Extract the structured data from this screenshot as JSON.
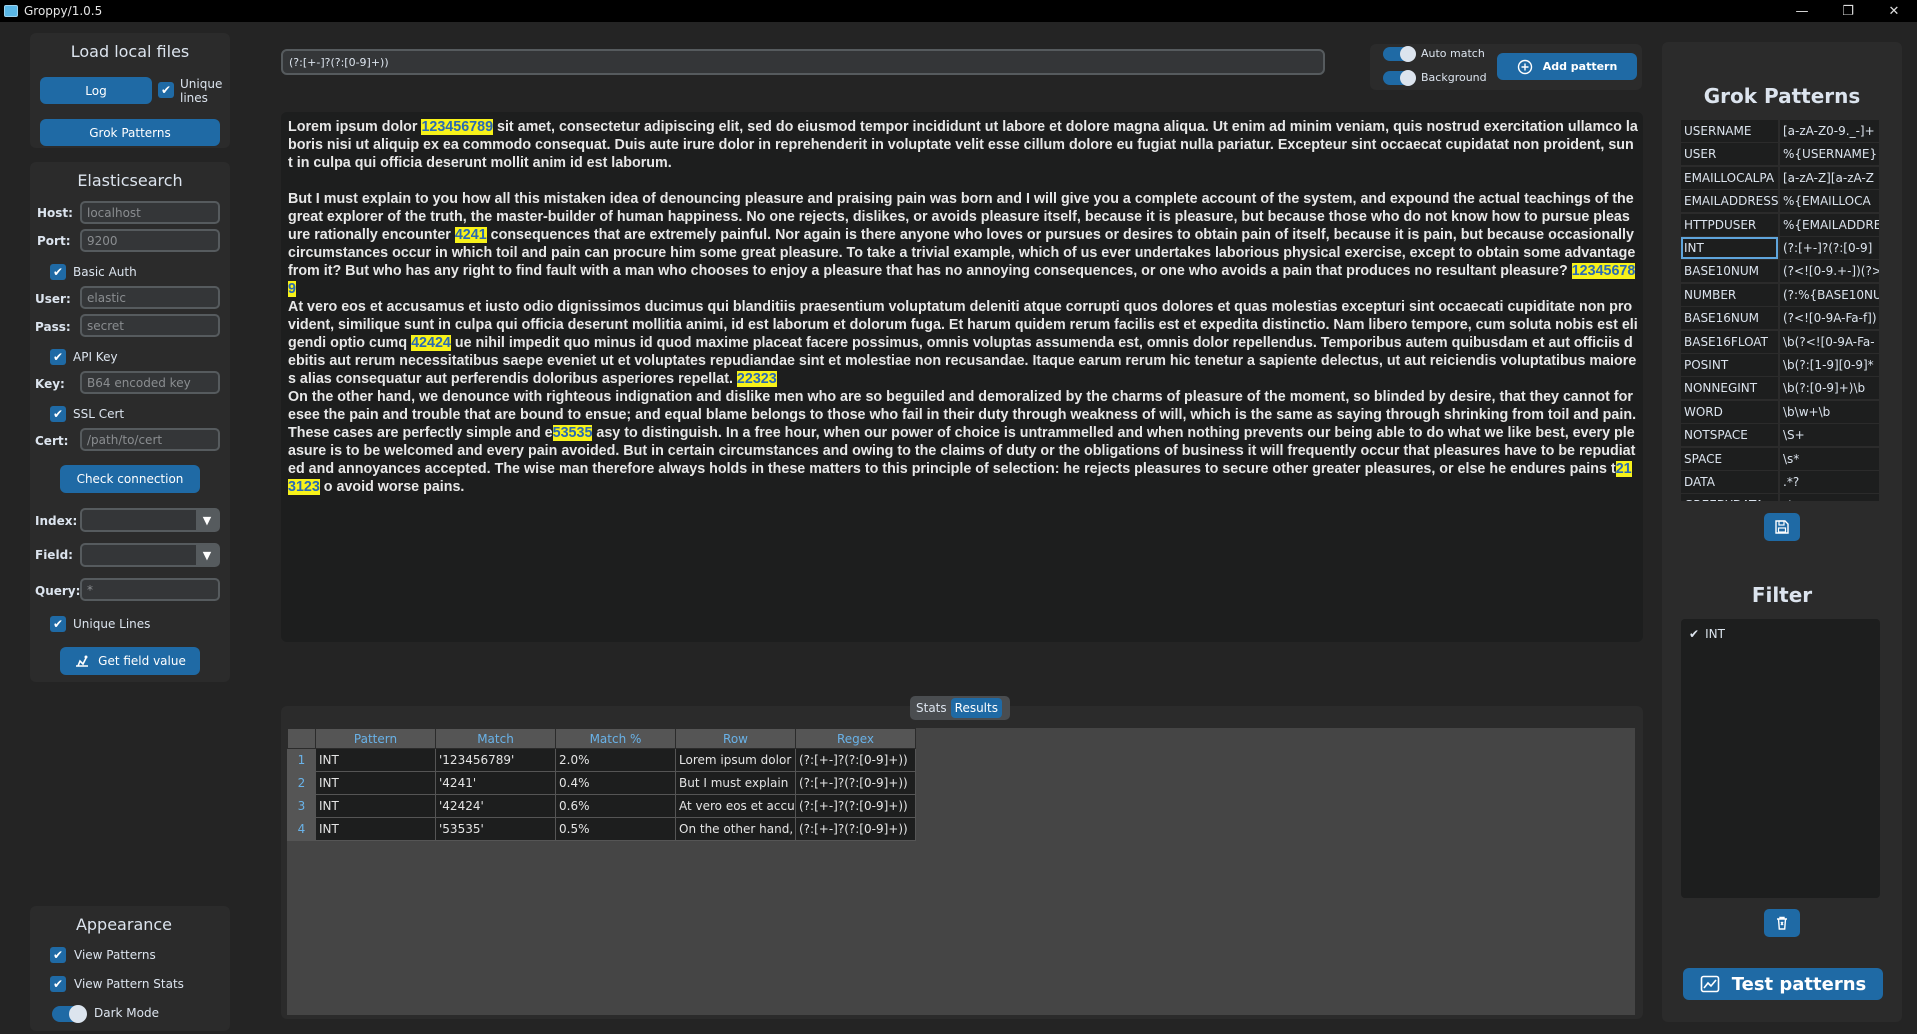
{
  "window": {
    "title": "Groppy/1.0.5"
  },
  "sidebar": {
    "load_title": "Load local files",
    "log_button": "Log",
    "unique_lines_label_1": "Unique",
    "unique_lines_label_2": "lines",
    "grok_button": "Grok Patterns",
    "es_title": "Elasticsearch",
    "host_label": "Host:",
    "host_placeholder": "localhost",
    "port_label": "Port:",
    "port_placeholder": "9200",
    "basic_auth_label": "Basic Auth",
    "user_label": "User:",
    "user_placeholder": "elastic",
    "pass_label": "Pass:",
    "pass_placeholder": "secret",
    "api_key_label": "API Key",
    "key_label": "Key:",
    "key_placeholder": "B64 encoded key",
    "ssl_label": "SSL Cert",
    "cert_label": "Cert:",
    "cert_placeholder": "/path/to/cert",
    "check_button": "Check connection",
    "index_label": "Index:",
    "field_label": "Field:",
    "query_label": "Query:",
    "query_placeholder": "*",
    "unique_lines": "Unique Lines",
    "get_field_button": "Get field value",
    "appearance_title": "Appearance",
    "view_patterns": "View Patterns",
    "view_pattern_stats": "View Pattern Stats",
    "dark_mode": "Dark Mode"
  },
  "toolbar": {
    "regex_value": "(?:[+-]?(?:[0-9]+))",
    "auto_match": "Auto match",
    "background": "Background",
    "add_pattern": "Add pattern"
  },
  "text": {
    "segments": [
      {
        "t": "Lorem ipsum dolor "
      },
      {
        "t": "123456789",
        "h": true
      },
      {
        "t": " sit amet, consectetur adipiscing elit, sed do eiusmod tempor incididunt ut labore et dolore magna aliqua. Ut enim ad minim veniam, quis nostrud exercitation ullamco laboris nisi ut aliquip ex ea commodo consequat. Duis aute irure dolor in reprehenderit in voluptate velit esse cillum dolore eu fugiat nulla pariatur. Excepteur sint occaecat cupidatat non proident, sunt in culpa qui officia deserunt mollit anim id est laborum.\n\nBut I must explain to you how all this mistaken idea of denouncing pleasure and praising pain was born and I will give you a complete account of the system, and expound the actual teachings of the great explorer of the truth, the master-builder of human happiness. No one rejects, dislikes, or avoids pleasure itself, because it is pleasure, but because those who do not know how to pursue pleasure rationally encounter "
      },
      {
        "t": "4241",
        "h": true
      },
      {
        "t": " consequences that are extremely painful. Nor again is there anyone who loves or pursues or desires to obtain pain of itself, because it is pain, but because occasionally circumstances occur in which toil and pain can procure him some great pleasure. To take a trivial example, which of us ever undertakes laborious physical exercise, except to obtain some advantage from it? But who has any right to find fault with a man who chooses to enjoy a pleasure that has no annoying consequences, or one who avoids a pain that produces no resultant pleasure? "
      },
      {
        "t": "123456789",
        "h": true
      },
      {
        "t": "\nAt vero eos et accusamus et iusto odio dignissimos ducimus qui blanditiis praesentium voluptatum deleniti atque corrupti quos dolores et quas molestias excepturi sint occaecati cupiditate non provident, similique sunt in culpa qui officia deserunt mollitia animi, id est laborum et dolorum fuga. Et harum quidem rerum facilis est et expedita distinctio. Nam libero tempore, cum soluta nobis est eligendi optio cumq "
      },
      {
        "t": "42424",
        "h": true
      },
      {
        "t": " ue nihil impedit quo minus id quod maxime placeat facere possimus, omnis voluptas assumenda est, omnis dolor repellendus. Temporibus autem quibusdam et aut officiis debitis aut rerum necessitatibus saepe eveniet ut et voluptates repudiandae sint et molestiae non recusandae. Itaque earum rerum hic tenetur a sapiente delectus, ut aut reiciendis voluptatibus maiores alias consequatur aut perferendis doloribus asperiores repellat. "
      },
      {
        "t": "22323",
        "h": true
      },
      {
        "t": "\nOn the other hand, we denounce with righteous indignation and dislike men who are so beguiled and demoralized by the charms of pleasure of the moment, so blinded by desire, that they cannot foresee the pain and trouble that are bound to ensue; and equal blame belongs to those who fail in their duty through weakness of will, which is the same as saying through shrinking from toil and pain. These cases are perfectly simple and e"
      },
      {
        "t": "53535",
        "h": true
      },
      {
        "t": " asy to distinguish. In a free hour, when our power of choice is untrammelled and when nothing prevents our being able to do what we like best, every pleasure is to be welcomed and every pain avoided. But in certain circumstances and owing to the claims of duty or the obligations of business it will frequently occur that pleasures have to be repudiated and annoyances accepted. The wise man therefore always holds in these matters to this principle of selection: he rejects pleasures to secure other greater pleasures, or else he endures pains t"
      },
      {
        "t": "213123",
        "h": true
      },
      {
        "t": " o avoid worse pains."
      }
    ]
  },
  "tabs": {
    "stats": "Stats",
    "results": "Results"
  },
  "results": {
    "columns": [
      "Pattern",
      "Match",
      "Match %",
      "Row",
      "Regex"
    ],
    "rows": [
      {
        "n": "1",
        "pattern": "INT",
        "match": "'123456789'",
        "pct": "2.0%",
        "row": "Lorem ipsum dolor",
        "regex": "(?:[+-]?(?:[0-9]+))"
      },
      {
        "n": "2",
        "pattern": "INT",
        "match": "'4241'",
        "pct": "0.4%",
        "row": "But I must explain",
        "regex": "(?:[+-]?(?:[0-9]+))"
      },
      {
        "n": "3",
        "pattern": "INT",
        "match": "'42424'",
        "pct": "0.6%",
        "row": "At vero eos et accu",
        "regex": "(?:[+-]?(?:[0-9]+))"
      },
      {
        "n": "4",
        "pattern": "INT",
        "match": "'53535'",
        "pct": "0.5%",
        "row": "On the other hand,",
        "regex": "(?:[+-]?(?:[0-9]+))"
      }
    ]
  },
  "grok": {
    "title": "Grok Patterns",
    "patterns": [
      {
        "name": "USERNAME",
        "regex": "[a-zA-Z0-9._-]+"
      },
      {
        "name": "USER",
        "regex": "%{USERNAME}"
      },
      {
        "name": "EMAILLOCALPA",
        "regex": "[a-zA-Z][a-zA-Z"
      },
      {
        "name": "EMAILADDRESS",
        "regex": "%{EMAILLOCA"
      },
      {
        "name": "HTTPDUSER",
        "regex": "%{EMAILADDRE"
      },
      {
        "name": "INT",
        "regex": "(?:[+-]?(?:[0-9]",
        "selected": true
      },
      {
        "name": "BASE10NUM",
        "regex": "(?<![0-9.+-])(?>"
      },
      {
        "name": "NUMBER",
        "regex": "(?:%{BASE10NU"
      },
      {
        "name": "BASE16NUM",
        "regex": "(?<![0-9A-Fa-f])"
      },
      {
        "name": "BASE16FLOAT",
        "regex": "\\b(?<![0-9A-Fa-"
      },
      {
        "name": "POSINT",
        "regex": "\\b(?:[1-9][0-9]*"
      },
      {
        "name": "NONNEGINT",
        "regex": "\\b(?:[0-9]+)\\b"
      },
      {
        "name": "WORD",
        "regex": "\\b\\w+\\b"
      },
      {
        "name": "NOTSPACE",
        "regex": "\\S+"
      },
      {
        "name": "SPACE",
        "regex": "\\s*"
      },
      {
        "name": "DATA",
        "regex": ".*?"
      },
      {
        "name": "GREEDYDATA",
        "regex": ".*"
      }
    ]
  },
  "filter": {
    "title": "Filter",
    "items": [
      {
        "label": "INT",
        "checked": true
      }
    ]
  },
  "test_button": "Test patterns",
  "colors": {
    "accent": "#1f6aa5",
    "highlight": "#f7f21a",
    "highlight_text": "#2a6ab4"
  }
}
